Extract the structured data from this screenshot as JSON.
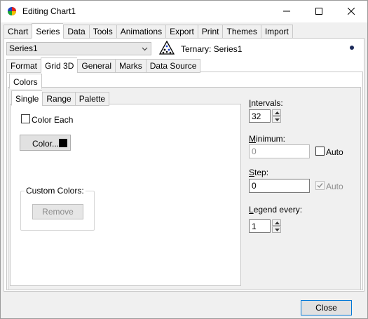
{
  "window": {
    "title": "Editing Chart1",
    "icon": "colorwheel-icon",
    "controls": [
      "minimize-icon",
      "maximize-icon",
      "close-icon"
    ]
  },
  "main_tabs": [
    "Chart",
    "Series",
    "Data",
    "Tools",
    "Animations",
    "Export",
    "Print",
    "Themes",
    "Import"
  ],
  "main_tabs_active": "Series",
  "series_select": {
    "value": "Series1"
  },
  "series_info": {
    "label": "Ternary: Series1"
  },
  "sub_tabs": [
    "Format",
    "Grid 3D",
    "General",
    "Marks",
    "Data Source"
  ],
  "sub_tabs_active": "Grid 3D",
  "color_tabs": [
    "Colors"
  ],
  "color_mode_tabs": [
    "Single",
    "Range",
    "Palette"
  ],
  "color_mode_active": "Single",
  "single": {
    "color_each_label": "Color Each",
    "color_each_checked": false,
    "color_button_label": "Color...",
    "color_swatch": "#000000",
    "custom_colors_legend": "Custom Colors:",
    "remove_label": "Remove"
  },
  "fields": {
    "intervals_label": "Intervals:",
    "intervals_value": "32",
    "minimum_label": "Minimum:",
    "minimum_value": "0",
    "minimum_auto_label": "Auto",
    "minimum_auto_checked": false,
    "step_label": "Step:",
    "step_value": "0",
    "step_auto_label": "Auto",
    "step_auto_checked": true,
    "legend_every_label": "Legend every:",
    "legend_every_value": "1"
  },
  "footer": {
    "close_label": "Close"
  }
}
